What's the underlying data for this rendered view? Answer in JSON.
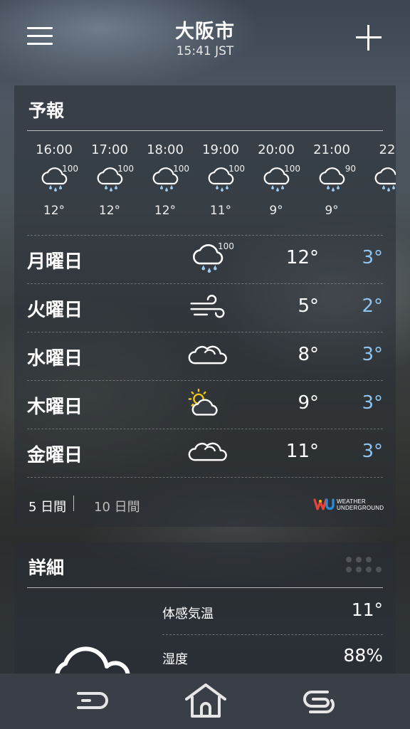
{
  "header": {
    "city": "大阪市",
    "time": "15:41 JST"
  },
  "forecast": {
    "title": "予報",
    "hourly": [
      {
        "time": "16:00",
        "icon": "rain-cloud-icon",
        "precip": "100",
        "temp": "12°"
      },
      {
        "time": "17:00",
        "icon": "rain-cloud-icon",
        "precip": "100",
        "temp": "12°"
      },
      {
        "time": "18:00",
        "icon": "rain-cloud-icon",
        "precip": "100",
        "temp": "12°"
      },
      {
        "time": "19:00",
        "icon": "rain-cloud-icon",
        "precip": "100",
        "temp": "11°"
      },
      {
        "time": "20:00",
        "icon": "rain-cloud-icon",
        "precip": "100",
        "temp": "9°"
      },
      {
        "time": "21:00",
        "icon": "rain-cloud-icon",
        "precip": "90",
        "temp": "9°"
      },
      {
        "time": "22",
        "icon": "rain-cloud-icon",
        "precip": "",
        "temp": ""
      }
    ],
    "daily": [
      {
        "day": "月曜日",
        "icon": "rain-cloud-icon",
        "precip": "100",
        "high": "12°",
        "low": "3°"
      },
      {
        "day": "火曜日",
        "icon": "wind-icon",
        "precip": "",
        "high": "5°",
        "low": "2°"
      },
      {
        "day": "水曜日",
        "icon": "cloudy-icon",
        "precip": "",
        "high": "8°",
        "low": "3°"
      },
      {
        "day": "木曜日",
        "icon": "partly-sunny-icon",
        "precip": "",
        "high": "9°",
        "low": "3°"
      },
      {
        "day": "金曜日",
        "icon": "cloudy-icon",
        "precip": "",
        "high": "11°",
        "low": "3°"
      }
    ],
    "tabs": {
      "five_day": "5 日間",
      "ten_day": "10 日間"
    },
    "provider": {
      "line1": "WEATHER",
      "line2": "UNDERGROUND"
    }
  },
  "details": {
    "title": "詳細",
    "rows": [
      {
        "label": "体感気温",
        "value": "11°"
      },
      {
        "label": "湿度",
        "value": "88%"
      }
    ]
  },
  "colors": {
    "low_temp": "#8fc3f0",
    "rain_drop": "#9cc9ee",
    "sun": "#f5c518"
  }
}
